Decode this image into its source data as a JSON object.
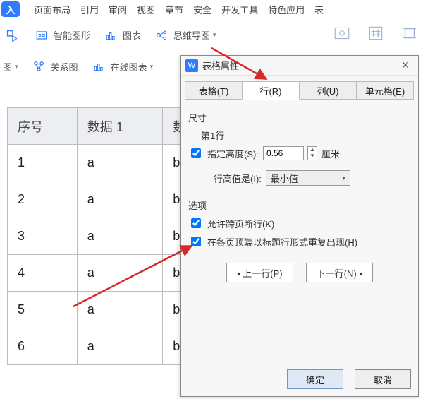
{
  "ribbon": {
    "tabs": [
      "页面布局",
      "引用",
      "审阅",
      "视图",
      "章节",
      "安全",
      "开发工具",
      "特色应用",
      "表"
    ]
  },
  "toolbar": {
    "items": [
      {
        "label": "智能图形"
      },
      {
        "label": "图表"
      },
      {
        "label": "思维导图"
      }
    ],
    "row2": [
      {
        "label": "图"
      },
      {
        "label": "关系图"
      },
      {
        "label": "在线图表"
      }
    ]
  },
  "table": {
    "headers": [
      "序号",
      "数据 1",
      "数据"
    ],
    "rows": [
      [
        "1",
        "a",
        "b"
      ],
      [
        "2",
        "a",
        "b"
      ],
      [
        "3",
        "a",
        "b"
      ],
      [
        "4",
        "a",
        "b"
      ],
      [
        "5",
        "a",
        "b"
      ],
      [
        "6",
        "a",
        "b"
      ]
    ]
  },
  "dialog": {
    "title": "表格属性",
    "tabs": {
      "t0": "表格(T)",
      "t1": "行(R)",
      "t2": "列(U)",
      "t3": "单元格(E)"
    },
    "section_size": "尺寸",
    "first_row": "第1行",
    "specify_height_label": "指定高度(S):",
    "height_value": "0.56",
    "height_unit": "厘米",
    "row_height_is_label": "行高值是(I):",
    "row_height_select": "最小值",
    "section_options": "选项",
    "allow_break_label": "允许跨页断行(K)",
    "repeat_header_label": "在各页顶端以标题行形式重复出现(H)",
    "prev_row_btn": "▪ 上一行(P)",
    "next_row_btn": "下一行(N) ▪",
    "ok": "确定",
    "cancel": "取消"
  }
}
